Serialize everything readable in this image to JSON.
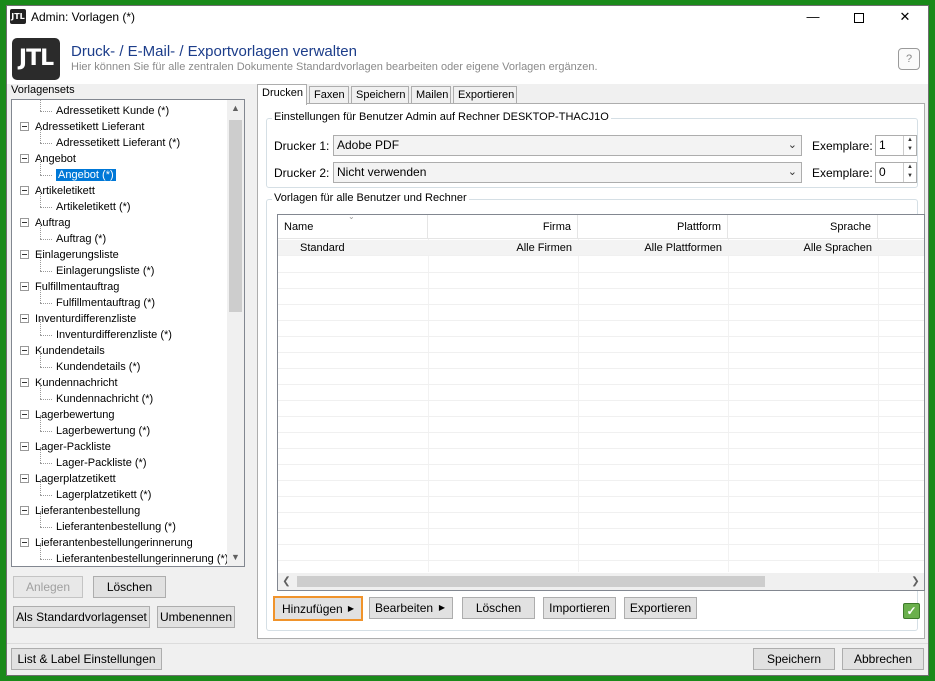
{
  "window": {
    "title": "Admin: Vorlagen (*)",
    "app_icon": "JTL"
  },
  "header": {
    "logo": "JTL",
    "title": "Druck- / E-Mail- / Exportvorlagen verwalten",
    "subtitle": "Hier können Sie für alle zentralen Dokumente Standardvorlagen bearbeiten oder eigene Vorlagen ergänzen.",
    "help_icon": "?"
  },
  "left": {
    "label": "Vorlagensets",
    "tree": [
      {
        "label": "Adressetikett Kunde (*)",
        "level": 1
      },
      {
        "label": "Adressetikett Lieferant",
        "level": 0
      },
      {
        "label": "Adressetikett Lieferant (*)",
        "level": 1
      },
      {
        "label": "Angebot",
        "level": 0
      },
      {
        "label": "Angebot (*)",
        "level": 1,
        "selected": true
      },
      {
        "label": "Artikeletikett",
        "level": 0
      },
      {
        "label": "Artikeletikett (*)",
        "level": 1
      },
      {
        "label": "Auftrag",
        "level": 0
      },
      {
        "label": "Auftrag (*)",
        "level": 1
      },
      {
        "label": "Einlagerungsliste",
        "level": 0
      },
      {
        "label": "Einlagerungsliste (*)",
        "level": 1
      },
      {
        "label": "Fulfillmentauftrag",
        "level": 0
      },
      {
        "label": "Fulfillmentauftrag (*)",
        "level": 1
      },
      {
        "label": "Inventurdifferenzliste",
        "level": 0
      },
      {
        "label": "Inventurdifferenzliste (*)",
        "level": 1
      },
      {
        "label": "Kundendetails",
        "level": 0
      },
      {
        "label": "Kundendetails (*)",
        "level": 1
      },
      {
        "label": "Kundennachricht",
        "level": 0
      },
      {
        "label": "Kundennachricht (*)",
        "level": 1
      },
      {
        "label": "Lagerbewertung",
        "level": 0
      },
      {
        "label": "Lagerbewertung (*)",
        "level": 1
      },
      {
        "label": "Lager-Packliste",
        "level": 0
      },
      {
        "label": "Lager-Packliste (*)",
        "level": 1
      },
      {
        "label": "Lagerplatzetikett",
        "level": 0
      },
      {
        "label": "Lagerplatzetikett (*)",
        "level": 1
      },
      {
        "label": "Lieferantenbestellung",
        "level": 0
      },
      {
        "label": "Lieferantenbestellung (*)",
        "level": 1
      },
      {
        "label": "Lieferantenbestellungerinnerung",
        "level": 0
      },
      {
        "label": "Lieferantenbestellungerinnerung (*)",
        "level": 1
      }
    ],
    "buttons": {
      "anlegen": "Anlegen",
      "loeschen": "Löschen",
      "standard": "Als Standardvorlagenset",
      "umbenennen": "Umbenennen"
    }
  },
  "tabs": [
    {
      "label": "Drucken",
      "active": true
    },
    {
      "label": "Faxen"
    },
    {
      "label": "Speichern"
    },
    {
      "label": "Mailen"
    },
    {
      "label": "Exportieren"
    }
  ],
  "printer_settings": {
    "group_label": "Einstellungen für Benutzer Admin auf Rechner DESKTOP-THACJ1O",
    "printer1_label": "Drucker 1:",
    "printer1_value": "Adobe PDF",
    "printer2_label": "Drucker 2:",
    "printer2_value": "Nicht verwenden",
    "copies_label": "Exemplare:",
    "copies1": "1",
    "copies2": "0"
  },
  "templates": {
    "group_label": "Vorlagen für alle Benutzer und Rechner",
    "columns": [
      "Name",
      "Firma",
      "Plattform",
      "Sprache"
    ],
    "rows": [
      {
        "name": "Standard",
        "firma": "Alle Firmen",
        "plattform": "Alle Plattformen",
        "sprache": "Alle Sprachen"
      }
    ]
  },
  "actions": {
    "hinzufuegen": "Hinzufügen",
    "bearbeiten": "Bearbeiten",
    "loeschen": "Löschen",
    "importieren": "Importieren",
    "exportieren": "Exportieren"
  },
  "footer": {
    "listlabel": "List & Label Einstellungen",
    "speichern": "Speichern",
    "abbrechen": "Abbrechen"
  },
  "colors": {
    "accent": "#0078d7",
    "highlight_border": "#f0932b",
    "header_title": "#1c3d8a",
    "frame": "#1a8a1a"
  }
}
